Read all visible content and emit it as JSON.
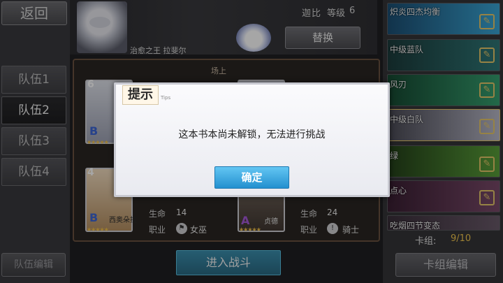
{
  "left": {
    "back_label": "返回",
    "teams": [
      "队伍1",
      "队伍2",
      "队伍3",
      "队伍4"
    ],
    "active_team_index": 1,
    "team_edit_label": "队伍编辑"
  },
  "leader": {
    "name": "治愈之王 拉斐尔",
    "character": "迦比",
    "level_label": "等级",
    "level_value": "6",
    "replace_label": "替换"
  },
  "field": {
    "label": "场上",
    "cards": [
      {
        "slot": "6",
        "rank": "B"
      },
      {
        "slot": "4",
        "rank": "B",
        "name": "西奥朵拉"
      },
      {
        "rank": "A",
        "name": "贞德"
      }
    ],
    "stats": [
      {
        "hp_label": "生命",
        "hp": "14",
        "job_label": "职业",
        "job": "女巫"
      },
      {
        "hp_label": "生命",
        "hp": "24",
        "job_label": "职业",
        "job": "骑士"
      }
    ],
    "enter_battle_label": "进入战斗"
  },
  "right": {
    "decks": [
      {
        "label": "炽炎四杰均衡",
        "color": "#2c7fb0"
      },
      {
        "label": "中级蓝队",
        "color": "#2a6a6a"
      },
      {
        "label": "风刃",
        "color": "#1f8a5a"
      },
      {
        "label": "中级白队",
        "color": "#a9a9b8"
      },
      {
        "label": "绿",
        "color": "#3f7a2a"
      },
      {
        "label": "点心",
        "color": "#6a3a5a"
      },
      {
        "label": "吃烟四节变态",
        "color": "#5a4a5a"
      }
    ],
    "deck_count_label": "卡组:",
    "deck_count_value": "9/10",
    "deck_edit_label": "卡组编辑"
  },
  "dialog": {
    "title": "提示",
    "subtitle": "Tips",
    "message": "这本书本尚未解锁，无法进行挑战",
    "confirm_label": "确定"
  }
}
